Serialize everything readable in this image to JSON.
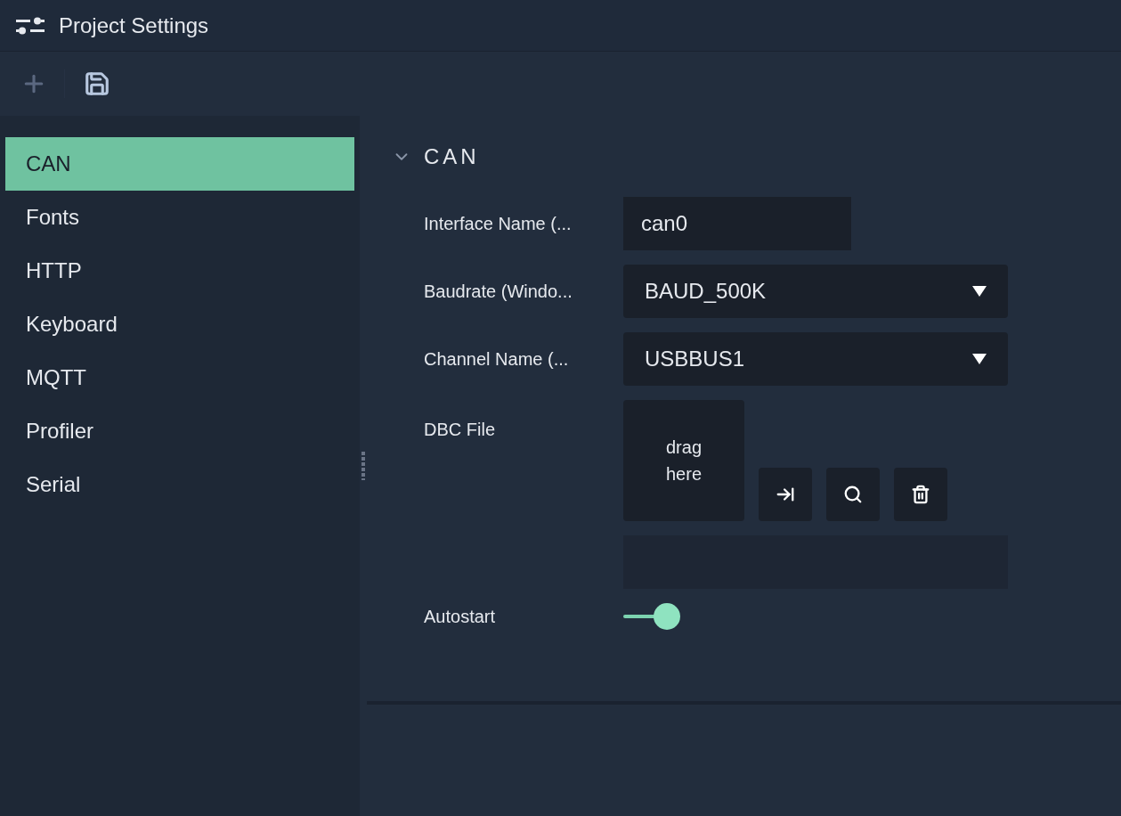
{
  "window": {
    "title": "Project Settings"
  },
  "sidebar": {
    "items": [
      {
        "label": "CAN",
        "selected": true
      },
      {
        "label": "Fonts",
        "selected": false
      },
      {
        "label": "HTTP",
        "selected": false
      },
      {
        "label": "Keyboard",
        "selected": false
      },
      {
        "label": "MQTT",
        "selected": false
      },
      {
        "label": "Profiler",
        "selected": false
      },
      {
        "label": "Serial",
        "selected": false
      }
    ]
  },
  "section": {
    "title": "CAN",
    "expanded": true,
    "fields": [
      {
        "kind": "text",
        "label": "Interface Name (...",
        "value": "can0"
      },
      {
        "kind": "select",
        "label": "Baudrate (Windo...",
        "value": "BAUD_500K"
      },
      {
        "kind": "select",
        "label": "Channel Name (...",
        "value": "USBBUS1"
      },
      {
        "kind": "file",
        "label": "DBC File",
        "drop_text": "drag here"
      },
      {
        "kind": "toggle",
        "label": "Autostart",
        "on": true
      }
    ]
  }
}
